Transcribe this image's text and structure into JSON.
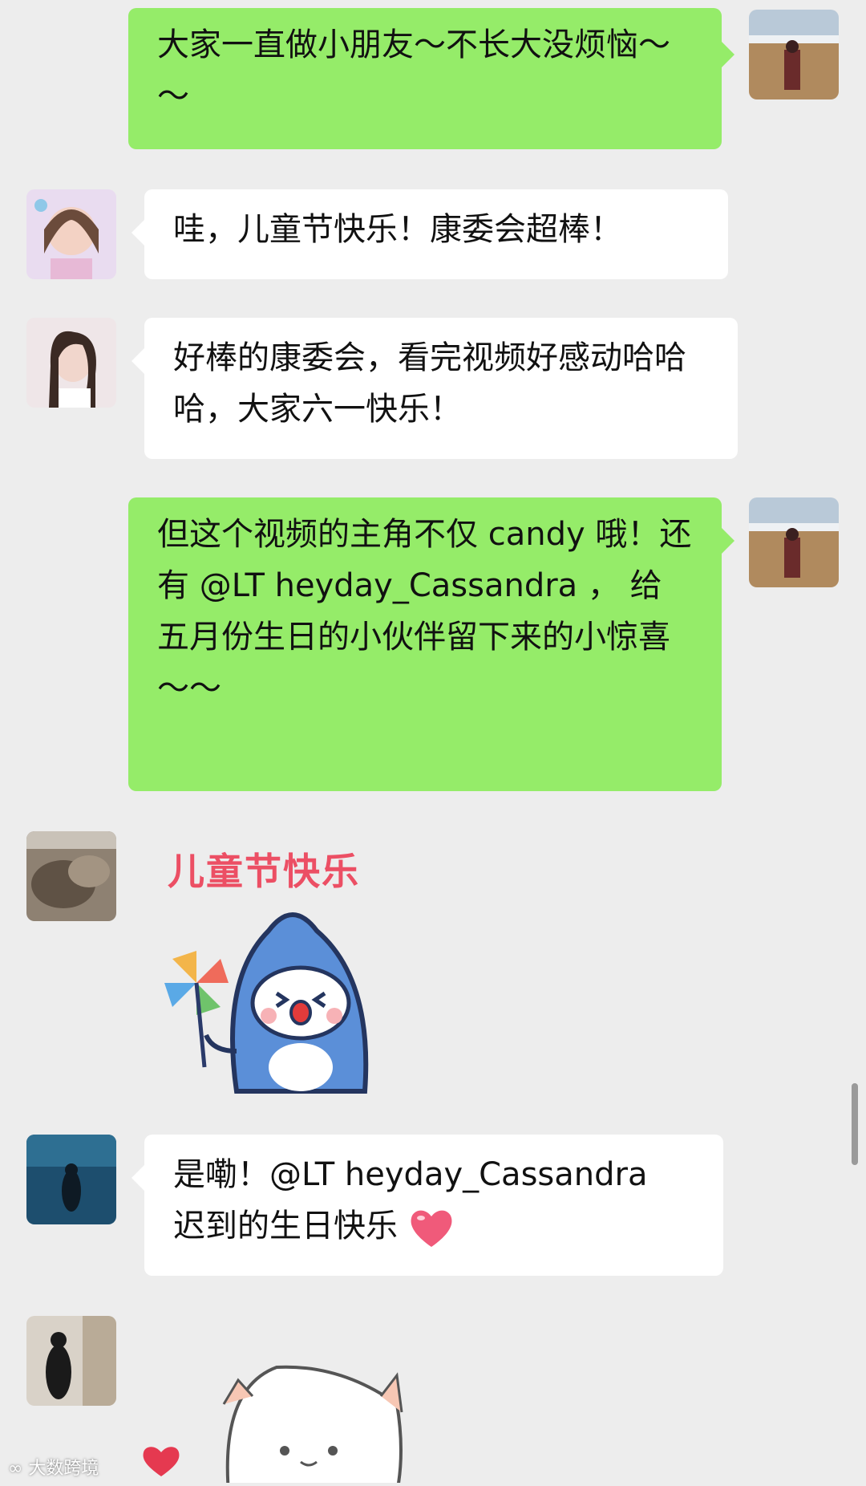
{
  "messages": [
    {
      "sender": "me",
      "text": "大家一直做小朋友～不长大没烦恼～～"
    },
    {
      "sender": "other",
      "text": "哇，儿童节快乐！康委会超棒！"
    },
    {
      "sender": "other",
      "text": "好棒的康委会，看完视频好感动哈哈哈，大家六一快乐！"
    },
    {
      "sender": "me",
      "text": "但这个视频的主角不仅 candy 哦！还有 @LT heyday_Cassandra ， 给五月份生日的小伙伴留下来的小惊喜～～"
    },
    {
      "sender": "other",
      "sticker_text": "儿童节快乐"
    },
    {
      "sender": "other",
      "text_line1": "是嘞！@LT heyday_Cassandra",
      "text_line2": "迟到的生日快乐"
    },
    {
      "sender": "other",
      "sticker": "white-cat-heart-sticker"
    }
  ],
  "watermark": "大数跨境",
  "colors": {
    "my_bubble": "#95ec69",
    "other_bubble": "#ffffff",
    "background": "#ededed"
  }
}
